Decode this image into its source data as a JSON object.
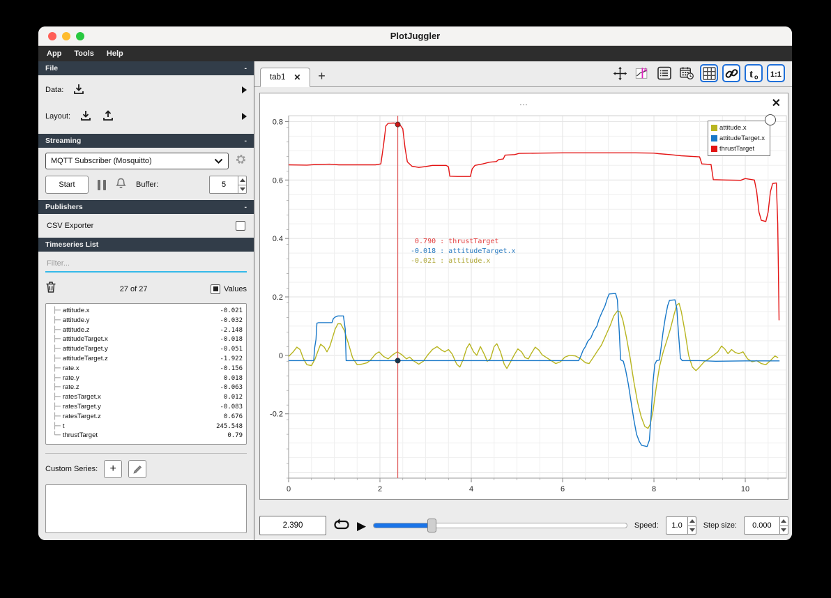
{
  "window": {
    "title": "PlotJuggler"
  },
  "menu": {
    "items": [
      "App",
      "Tools",
      "Help"
    ]
  },
  "icons": {
    "close": "✕",
    "add": "+",
    "collapse": "-",
    "play": "▶"
  },
  "sidebar": {
    "file": {
      "title": "File",
      "data_label": "Data:",
      "layout_label": "Layout:"
    },
    "streaming": {
      "title": "Streaming",
      "source": "MQTT Subscriber (Mosquitto)",
      "start": "Start",
      "buffer_label": "Buffer:",
      "buffer": "5"
    },
    "publishers": {
      "title": "Publishers",
      "csv": "CSV Exporter"
    },
    "timeseries": {
      "title": "Timeseries List",
      "filter_placeholder": "Filter...",
      "count": "27 of 27",
      "values_label": "Values",
      "items": [
        {
          "name": "attitude.x",
          "value": "-0.021"
        },
        {
          "name": "attitude.y",
          "value": "-0.032"
        },
        {
          "name": "attitude.z",
          "value": "-2.148"
        },
        {
          "name": "attitudeTarget.x",
          "value": "-0.018"
        },
        {
          "name": "attitudeTarget.y",
          "value": "-0.051"
        },
        {
          "name": "attitudeTarget.z",
          "value": "-1.922"
        },
        {
          "name": "rate.x",
          "value": "-0.156"
        },
        {
          "name": "rate.y",
          "value": "0.018"
        },
        {
          "name": "rate.z",
          "value": "-0.063"
        },
        {
          "name": "ratesTarget.x",
          "value": "0.012"
        },
        {
          "name": "ratesTarget.y",
          "value": "-0.083"
        },
        {
          "name": "ratesTarget.z",
          "value": "0.676"
        },
        {
          "name": "t",
          "value": "245.548"
        },
        {
          "name": "thrustTarget",
          "value": "0.79"
        }
      ]
    },
    "custom": {
      "label": "Custom Series:"
    }
  },
  "tabs": {
    "active": "tab1"
  },
  "plot": {
    "legend": [
      {
        "label": "attitude.x",
        "color": "#b8b520"
      },
      {
        "label": "attitudeTarget.x",
        "color": "#1878c8"
      },
      {
        "label": "thrustTarget",
        "color": "#e31414"
      }
    ],
    "tooltip": [
      {
        "value": "0.790",
        "label": "thrustTarget",
        "color": "#e34040"
      },
      {
        "value": "-0.018",
        "label": "attitudeTarget.x",
        "color": "#2b7bc0"
      },
      {
        "value": "-0.021",
        "label": "attitude.x",
        "color": "#b0a83a"
      }
    ]
  },
  "transport": {
    "time": "2.390",
    "speed_label": "Speed:",
    "speed": "1.0",
    "step_label": "Step size:",
    "step": "0.000",
    "progress_pct": 23
  },
  "chart_data": {
    "type": "line",
    "title": "...",
    "xlabel": "",
    "ylabel": "",
    "xlim": [
      0,
      10.9
    ],
    "ylim": [
      -0.42,
      0.82
    ],
    "xticks": [
      0,
      2,
      4,
      6,
      8,
      10
    ],
    "xtick_labels": [
      "0",
      "2",
      "4",
      "6",
      "8",
      "10"
    ],
    "yticks": [
      0.8,
      0.6,
      0.4,
      0.2,
      0,
      -0.2
    ],
    "ytick_labels": [
      "0.8",
      "0.6",
      "0.4",
      "0.2",
      "0",
      "-0.2"
    ],
    "x_minor_step": 0.5,
    "y_minor_step": 0.05,
    "grid": true,
    "legend_position": "top-right",
    "tracker": {
      "x": 2.39,
      "points": [
        {
          "y": 0.79,
          "color": "#cc1515"
        },
        {
          "y": -0.018,
          "color": "#16354f"
        }
      ]
    },
    "series": [
      {
        "name": "attitude.x",
        "color": "#b8b520",
        "points": [
          [
            0,
            -0.004
          ],
          [
            0.1,
            0.012
          ],
          [
            0.18,
            0.028
          ],
          [
            0.25,
            0.02
          ],
          [
            0.32,
            -0.01
          ],
          [
            0.4,
            -0.032
          ],
          [
            0.5,
            -0.035
          ],
          [
            0.58,
            -0.012
          ],
          [
            0.65,
            0.018
          ],
          [
            0.7,
            0.038
          ],
          [
            0.78,
            0.028
          ],
          [
            0.84,
            0.012
          ],
          [
            0.9,
            0.03
          ],
          [
            0.96,
            0.06
          ],
          [
            1.02,
            0.09
          ],
          [
            1.08,
            0.108
          ],
          [
            1.14,
            0.108
          ],
          [
            1.22,
            0.085
          ],
          [
            1.3,
            0.045
          ],
          [
            1.4,
            -0.008
          ],
          [
            1.5,
            -0.032
          ],
          [
            1.6,
            -0.03
          ],
          [
            1.72,
            -0.025
          ],
          [
            1.8,
            -0.015
          ],
          [
            1.9,
            0.004
          ],
          [
            1.98,
            0.012
          ],
          [
            2.08,
            -0.004
          ],
          [
            2.18,
            -0.012
          ],
          [
            2.28,
            0.002
          ],
          [
            2.38,
            0.012
          ],
          [
            2.48,
            0.002
          ],
          [
            2.58,
            -0.012
          ],
          [
            2.65,
            -0.006
          ],
          [
            2.75,
            -0.02
          ],
          [
            2.85,
            -0.03
          ],
          [
            2.95,
            -0.02
          ],
          [
            3.05,
            0.002
          ],
          [
            3.15,
            0.02
          ],
          [
            3.25,
            0.03
          ],
          [
            3.35,
            0.018
          ],
          [
            3.42,
            0.012
          ],
          [
            3.5,
            0.02
          ],
          [
            3.58,
            0.005
          ],
          [
            3.68,
            -0.03
          ],
          [
            3.75,
            -0.04
          ],
          [
            3.82,
            -0.015
          ],
          [
            3.9,
            0.025
          ],
          [
            3.96,
            0.04
          ],
          [
            4.05,
            0.012
          ],
          [
            4.12,
            0
          ],
          [
            4.2,
            0.03
          ],
          [
            4.28,
            0.005
          ],
          [
            4.35,
            -0.02
          ],
          [
            4.42,
            -0.012
          ],
          [
            4.5,
            0.03
          ],
          [
            4.56,
            0.04
          ],
          [
            4.64,
            0.012
          ],
          [
            4.72,
            -0.03
          ],
          [
            4.78,
            -0.045
          ],
          [
            4.85,
            -0.025
          ],
          [
            4.95,
            0.004
          ],
          [
            5.02,
            0.022
          ],
          [
            5.1,
            0.012
          ],
          [
            5.18,
            -0.008
          ],
          [
            5.25,
            -0.012
          ],
          [
            5.32,
            0.008
          ],
          [
            5.4,
            0.028
          ],
          [
            5.48,
            0.018
          ],
          [
            5.55,
            0.002
          ],
          [
            5.65,
            -0.008
          ],
          [
            5.75,
            -0.018
          ],
          [
            5.85,
            -0.028
          ],
          [
            5.95,
            -0.022
          ],
          [
            6.05,
            -0.006
          ],
          [
            6.15,
            0
          ],
          [
            6.28,
            -0.002
          ],
          [
            6.4,
            -0.012
          ],
          [
            6.5,
            -0.025
          ],
          [
            6.58,
            -0.028
          ],
          [
            6.65,
            -0.012
          ],
          [
            6.75,
            0.012
          ],
          [
            6.85,
            0.035
          ],
          [
            6.95,
            0.07
          ],
          [
            7.05,
            0.105
          ],
          [
            7.12,
            0.135
          ],
          [
            7.2,
            0.152
          ],
          [
            7.26,
            0.148
          ],
          [
            7.32,
            0.12
          ],
          [
            7.4,
            0.06
          ],
          [
            7.48,
            -0.01
          ],
          [
            7.56,
            -0.09
          ],
          [
            7.64,
            -0.16
          ],
          [
            7.72,
            -0.21
          ],
          [
            7.8,
            -0.243
          ],
          [
            7.87,
            -0.25
          ],
          [
            7.92,
            -0.235
          ],
          [
            7.98,
            -0.19
          ],
          [
            8.05,
            -0.11
          ],
          [
            8.12,
            -0.04
          ],
          [
            8.2,
            0.01
          ],
          [
            8.28,
            0.05
          ],
          [
            8.36,
            0.09
          ],
          [
            8.44,
            0.14
          ],
          [
            8.5,
            0.172
          ],
          [
            8.55,
            0.178
          ],
          [
            8.6,
            0.15
          ],
          [
            8.68,
            0.08
          ],
          [
            8.76,
            0
          ],
          [
            8.84,
            -0.04
          ],
          [
            8.92,
            -0.052
          ],
          [
            9,
            -0.04
          ],
          [
            9.1,
            -0.022
          ],
          [
            9.2,
            -0.012
          ],
          [
            9.3,
            0
          ],
          [
            9.4,
            0.012
          ],
          [
            9.48,
            0.032
          ],
          [
            9.55,
            0.022
          ],
          [
            9.62,
            0.006
          ],
          [
            9.7,
            0.02
          ],
          [
            9.78,
            0.01
          ],
          [
            9.86,
            0.006
          ],
          [
            9.95,
            0.012
          ],
          [
            10.05,
            -0.012
          ],
          [
            10.15,
            -0.022
          ],
          [
            10.25,
            -0.018
          ],
          [
            10.35,
            -0.028
          ],
          [
            10.45,
            -0.032
          ],
          [
            10.55,
            -0.018
          ],
          [
            10.65,
            -0.002
          ],
          [
            10.72,
            -0.008
          ]
        ]
      },
      {
        "name": "attitudeTarget.x",
        "color": "#1878c8",
        "points": [
          [
            0,
            -0.018
          ],
          [
            0.55,
            -0.018
          ],
          [
            0.57,
            0.025
          ],
          [
            0.6,
            0.055
          ],
          [
            0.62,
            0.11
          ],
          [
            0.66,
            0.112
          ],
          [
            0.95,
            0.112
          ],
          [
            0.98,
            0.126
          ],
          [
            1.02,
            0.131
          ],
          [
            1.08,
            0.135
          ],
          [
            1.2,
            0.135
          ],
          [
            1.24,
            0.09
          ],
          [
            1.26,
            -0.018
          ],
          [
            2,
            -0.018
          ],
          [
            3,
            -0.018
          ],
          [
            4,
            -0.018
          ],
          [
            5,
            -0.018
          ],
          [
            6,
            -0.018
          ],
          [
            6.35,
            -0.018
          ],
          [
            6.4,
            -0.002
          ],
          [
            6.45,
            0.018
          ],
          [
            6.5,
            0.03
          ],
          [
            6.55,
            0.048
          ],
          [
            6.62,
            0.06
          ],
          [
            6.68,
            0.083
          ],
          [
            6.75,
            0.1
          ],
          [
            6.8,
            0.125
          ],
          [
            6.87,
            0.15
          ],
          [
            6.93,
            0.17
          ],
          [
            6.98,
            0.195
          ],
          [
            7.02,
            0.21
          ],
          [
            7.16,
            0.212
          ],
          [
            7.2,
            0.19
          ],
          [
            7.24,
            0.08
          ],
          [
            7.27,
            -0.015
          ],
          [
            7.33,
            -0.02
          ],
          [
            7.38,
            -0.05
          ],
          [
            7.44,
            -0.1
          ],
          [
            7.5,
            -0.16
          ],
          [
            7.56,
            -0.22
          ],
          [
            7.62,
            -0.27
          ],
          [
            7.68,
            -0.295
          ],
          [
            7.73,
            -0.308
          ],
          [
            7.85,
            -0.312
          ],
          [
            7.9,
            -0.29
          ],
          [
            7.94,
            -0.2
          ],
          [
            7.98,
            -0.09
          ],
          [
            8.02,
            -0.03
          ],
          [
            8.06,
            -0.018
          ],
          [
            8.12,
            -0.016
          ],
          [
            8.16,
            0.03
          ],
          [
            8.2,
            0.08
          ],
          [
            8.25,
            0.13
          ],
          [
            8.3,
            0.17
          ],
          [
            8.34,
            0.188
          ],
          [
            8.46,
            0.19
          ],
          [
            8.5,
            0.16
          ],
          [
            8.54,
            0.07
          ],
          [
            8.58,
            -0.01
          ],
          [
            8.62,
            -0.018
          ],
          [
            9,
            -0.018
          ],
          [
            9.35,
            -0.02
          ],
          [
            10,
            -0.019
          ],
          [
            10.75,
            -0.019
          ]
        ]
      },
      {
        "name": "thrustTarget",
        "color": "#e31414",
        "points": [
          [
            0,
            0.652
          ],
          [
            0.4,
            0.651
          ],
          [
            0.6,
            0.653
          ],
          [
            0.9,
            0.654
          ],
          [
            1.1,
            0.652
          ],
          [
            1.5,
            0.652
          ],
          [
            1.9,
            0.652
          ],
          [
            2.02,
            0.655
          ],
          [
            2.08,
            0.72
          ],
          [
            2.13,
            0.785
          ],
          [
            2.18,
            0.794
          ],
          [
            2.3,
            0.795
          ],
          [
            2.42,
            0.793
          ],
          [
            2.5,
            0.775
          ],
          [
            2.55,
            0.71
          ],
          [
            2.6,
            0.662
          ],
          [
            2.7,
            0.647
          ],
          [
            2.85,
            0.643
          ],
          [
            3,
            0.646
          ],
          [
            3.15,
            0.65
          ],
          [
            3.45,
            0.65
          ],
          [
            3.5,
            0.645
          ],
          [
            3.53,
            0.613
          ],
          [
            3.7,
            0.612
          ],
          [
            3.98,
            0.612
          ],
          [
            4.02,
            0.638
          ],
          [
            4.08,
            0.65
          ],
          [
            4.25,
            0.655
          ],
          [
            4.4,
            0.661
          ],
          [
            4.55,
            0.663
          ],
          [
            4.6,
            0.67
          ],
          [
            4.7,
            0.672
          ],
          [
            4.74,
            0.685
          ],
          [
            4.95,
            0.687
          ],
          [
            5.05,
            0.691
          ],
          [
            5.5,
            0.692
          ],
          [
            6,
            0.693
          ],
          [
            6.5,
            0.693
          ],
          [
            7,
            0.693
          ],
          [
            7.6,
            0.693
          ],
          [
            8,
            0.692
          ],
          [
            8.1,
            0.69
          ],
          [
            8.35,
            0.687
          ],
          [
            8.6,
            0.683
          ],
          [
            8.9,
            0.68
          ],
          [
            9,
            0.679
          ],
          [
            9.05,
            0.655
          ],
          [
            9.25,
            0.653
          ],
          [
            9.3,
            0.601
          ],
          [
            9.6,
            0.6
          ],
          [
            9.9,
            0.599
          ],
          [
            10,
            0.605
          ],
          [
            10.2,
            0.6
          ],
          [
            10.25,
            0.56
          ],
          [
            10.3,
            0.49
          ],
          [
            10.35,
            0.462
          ],
          [
            10.45,
            0.458
          ],
          [
            10.5,
            0.49
          ],
          [
            10.55,
            0.56
          ],
          [
            10.6,
            0.588
          ],
          [
            10.68,
            0.59
          ],
          [
            10.71,
            0.45
          ],
          [
            10.73,
            0.23
          ],
          [
            10.74,
            0.12
          ]
        ]
      }
    ]
  }
}
